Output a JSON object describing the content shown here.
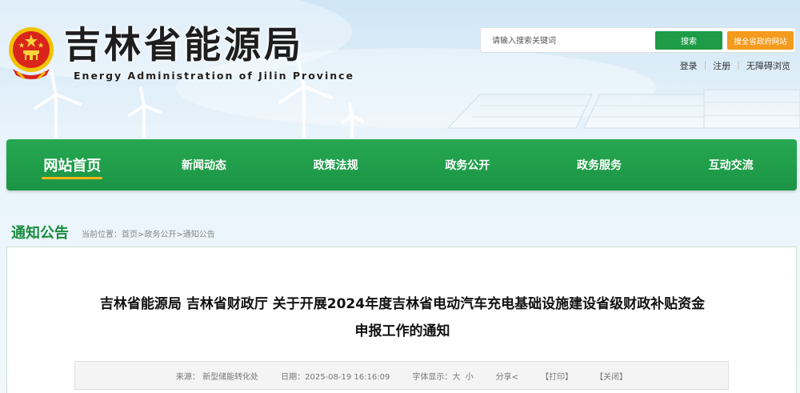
{
  "header": {
    "title": "吉林省能源局",
    "subtitle": "Energy Administration of Jilin Province"
  },
  "search": {
    "placeholder": "请输入搜索关键词",
    "button_label": "搜索",
    "all_sites_label": "搜全省政府网站"
  },
  "top_links": {
    "login": "登录",
    "register": "注册",
    "accessibility": "无障碍浏览"
  },
  "nav": {
    "items": [
      {
        "label": "网站首页"
      },
      {
        "label": "新闻动态"
      },
      {
        "label": "政策法规"
      },
      {
        "label": "政务公开"
      },
      {
        "label": "政务服务"
      },
      {
        "label": "互动交流"
      }
    ]
  },
  "section": {
    "title": "通知公告"
  },
  "breadcrumb": {
    "prefix": "当前位置：",
    "home": "首页",
    "sep": ">",
    "level1": "政务公开",
    "level2": "通知公告"
  },
  "article": {
    "title_line1": "吉林省能源局 吉林省财政厅 关于开展2024年度吉林省电动汽车充电基础设施建设省级财政补贴资金",
    "title_line2": "申报工作的通知",
    "meta": {
      "source_label": "来源：",
      "source_value": "新型储能转化处",
      "date_label": "日期：",
      "date_value": "2025-08-19 16:16:09",
      "font_label": "字体显示：",
      "font_large": "大",
      "font_small": "小",
      "share": "分享<",
      "print": "【打印】",
      "close": "【关闭】"
    }
  },
  "colors": {
    "nav_green": "#1e9b47",
    "accent_orange": "#f49a1c",
    "title_green": "#1a8d3f",
    "active_underline": "#f5b51c"
  }
}
